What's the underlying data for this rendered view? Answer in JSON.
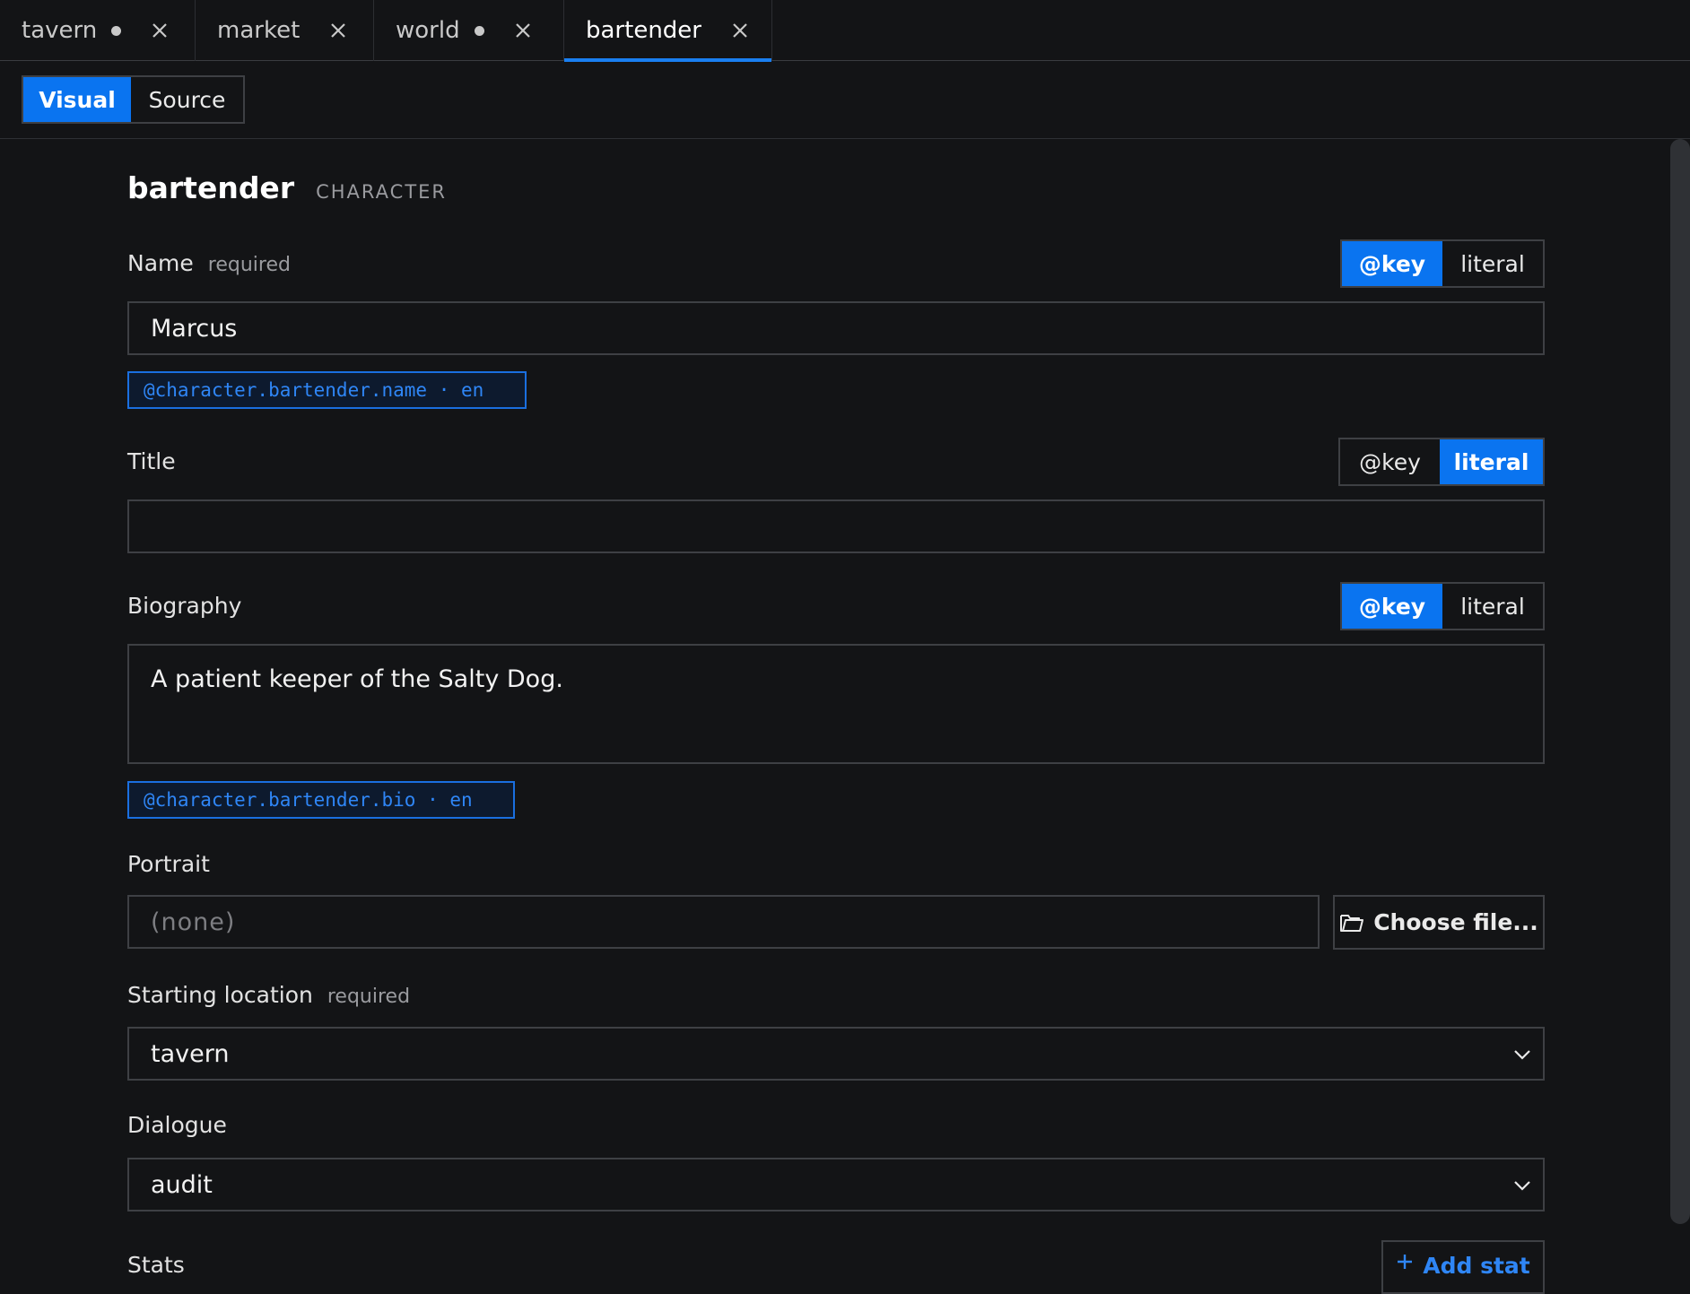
{
  "tabs": [
    {
      "label": "tavern",
      "modified": true,
      "active": false
    },
    {
      "label": "market",
      "modified": false,
      "active": false
    },
    {
      "label": "world",
      "modified": true,
      "active": false
    },
    {
      "label": "bartender",
      "modified": false,
      "active": true
    }
  ],
  "view": {
    "visual": "Visual",
    "source": "Source",
    "selected": "Visual"
  },
  "heading": {
    "name": "bartender",
    "kind": "CHARACTER"
  },
  "mode_toggle": {
    "key": "@key",
    "literal": "literal"
  },
  "fields": {
    "name": {
      "label": "Name",
      "required": "required",
      "value": "Marcus",
      "mode": "@key",
      "key_ref": "@character.bartender.name · en"
    },
    "title": {
      "label": "Title",
      "value": "",
      "mode": "literal"
    },
    "biography": {
      "label": "Biography",
      "value": "A patient keeper of the Salty Dog.",
      "mode": "@key",
      "key_ref": "@character.bartender.bio · en"
    },
    "portrait": {
      "label": "Portrait",
      "placeholder": "(none)",
      "choose_label": "Choose file..."
    },
    "starting_location": {
      "label": "Starting location",
      "required": "required",
      "value": "tavern"
    },
    "dialogue": {
      "label": "Dialogue",
      "value": "audit"
    },
    "stats": {
      "label": "Stats",
      "add_label": "Add stat"
    }
  },
  "colors": {
    "accent": "#0a74f0",
    "key_chip": "#2f86f6",
    "background": "#131416"
  }
}
